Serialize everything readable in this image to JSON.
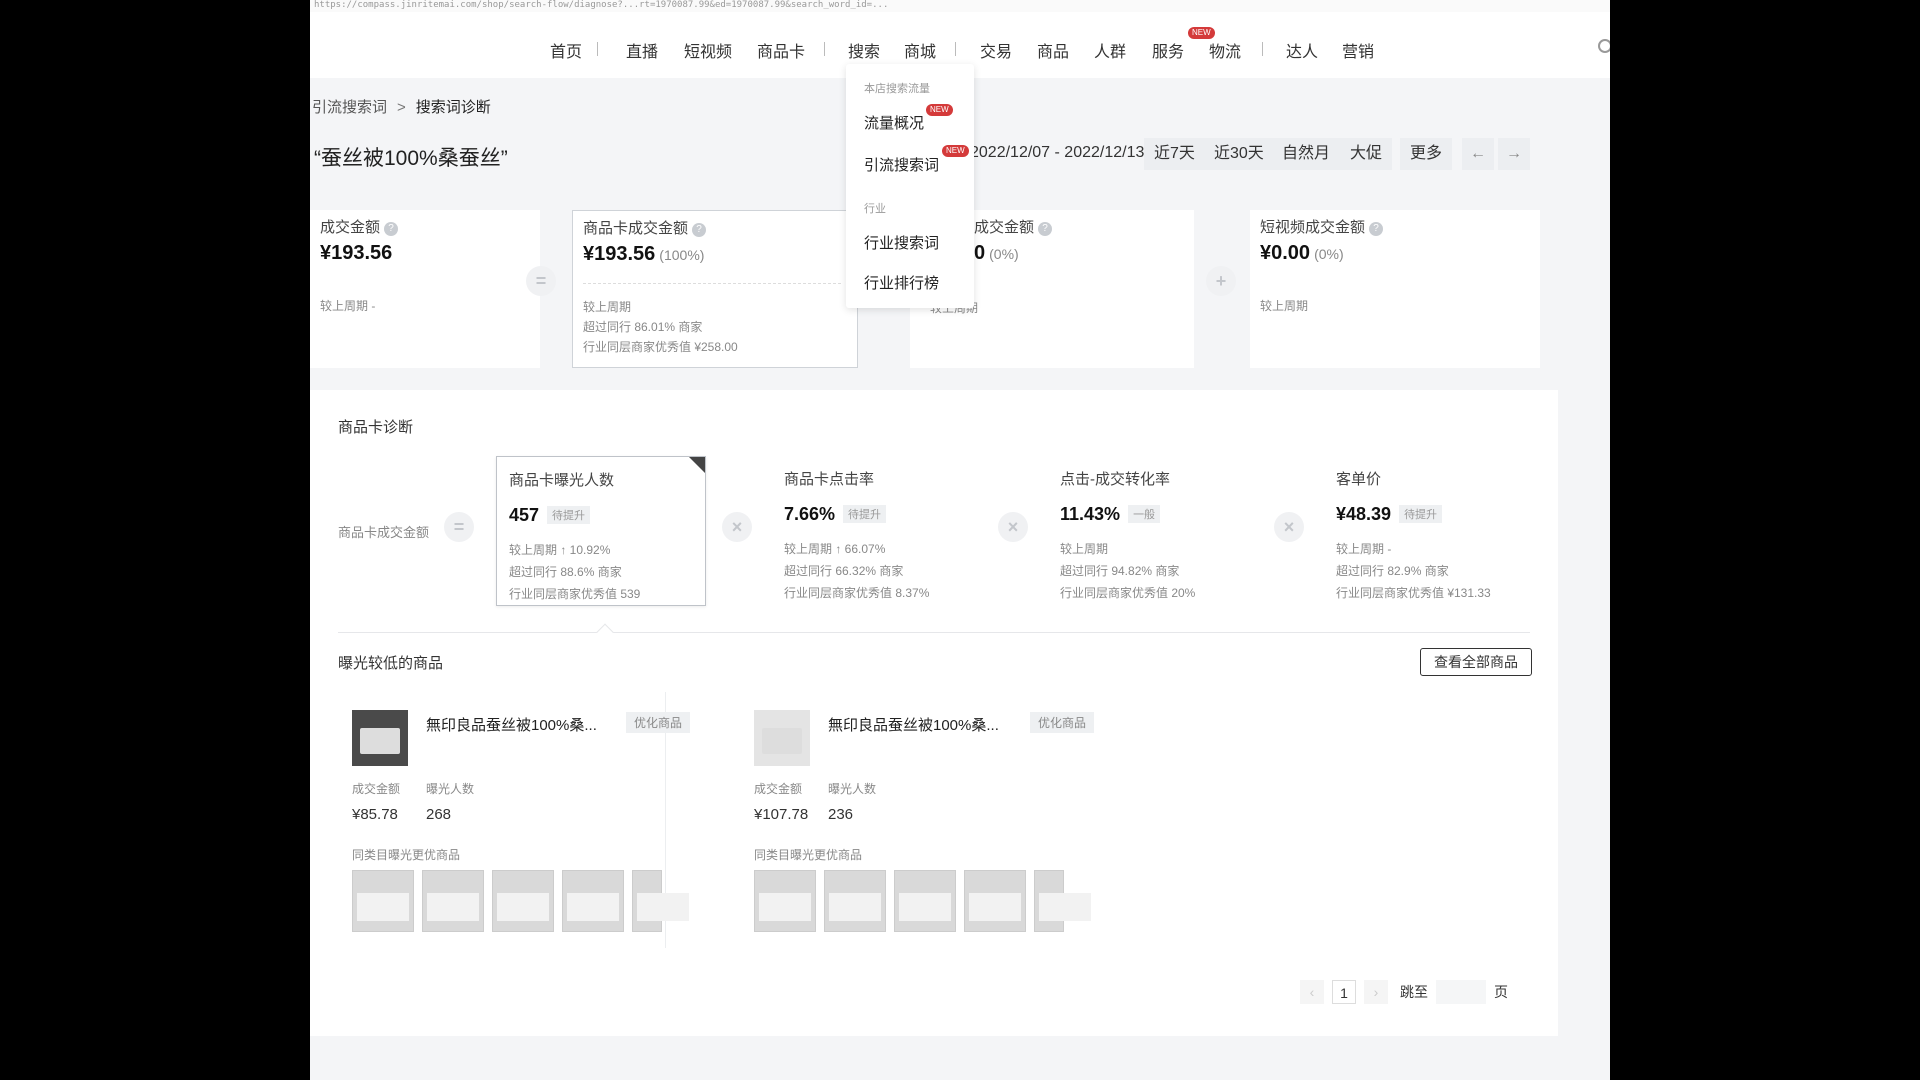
{
  "url": "https://compass.jinritemai.com/shop/search-flow/diagnose?...rt=1970087.99&ed=1970087.99&search_word_id=...",
  "topnav": {
    "items": [
      "首页",
      "直播",
      "短视频",
      "商品卡",
      "搜索",
      "商城",
      "交易",
      "商品",
      "人群",
      "服务",
      "物流",
      "达人",
      "营销"
    ],
    "new_badge": "NEW"
  },
  "breadcrumb": {
    "parent": "引流搜索词",
    "current": "搜索词诊断"
  },
  "keyword": "“蚕丝被100%桑蚕丝”",
  "date_range": "2022/12/07 - 2022/12/13",
  "range_tabs": [
    "近7天",
    "近30天",
    "自然月",
    "大促",
    "更多"
  ],
  "dropdown": {
    "group1": "本店搜索流量",
    "item1": "流量概况",
    "item2": "引流搜索词",
    "group2": "行业",
    "item3": "行业搜索词",
    "item4": "行业排行榜",
    "new_badge": "NEW"
  },
  "metrics": [
    {
      "label": "成交金额",
      "value": "¥193.56",
      "pct": "",
      "sub": [
        "较上周期 -"
      ]
    },
    {
      "label": "商品卡成交金额",
      "value": "¥193.56",
      "pct": "(100%)",
      "sub": [
        "较上周期",
        "超过同行 86.01% 商家",
        "行业同层商家优秀值 ¥258.00"
      ]
    },
    {
      "label": "成交金额",
      "value": "0",
      "pct": "(0%)",
      "sub": [
        "较上周期"
      ]
    },
    {
      "label": "短视频成交金额",
      "value": "¥0.00",
      "pct": "(0%)",
      "sub": [
        "较上周期"
      ]
    }
  ],
  "diagnose": {
    "title": "商品卡诊断",
    "left_label": "商品卡成交金额",
    "cards": [
      {
        "label": "商品卡曝光人数",
        "value": "457",
        "tag": "待提升",
        "sub": [
          "较上周期 ↑ 10.92%",
          "超过同行 88.6% 商家",
          "行业同层商家优秀值 539"
        ]
      },
      {
        "label": "商品卡点击率",
        "value": "7.66%",
        "tag": "待提升",
        "sub": [
          "较上周期 ↑ 66.07%",
          "超过同行 66.32% 商家",
          "行业同层商家优秀值 8.37%"
        ]
      },
      {
        "label": "点击-成交转化率",
        "value": "11.43%",
        "tag": "一般",
        "sub": [
          "较上周期",
          "超过同行 94.82% 商家",
          "行业同层商家优秀值 20%"
        ]
      },
      {
        "label": "客单价",
        "value": "¥48.39",
        "tag": "待提升",
        "sub": [
          "较上周期 -",
          "超过同行 82.9% 商家",
          "行业同层商家优秀值 ¥131.33"
        ]
      }
    ]
  },
  "low_exposure": {
    "title": "曝光较低的商品",
    "view_all": "查看全部商品",
    "products": [
      {
        "name": "無印良品蚕丝被100%桑...",
        "tag": "优化商品",
        "k1": "成交金额",
        "k2": "曝光人数",
        "v1": "¥85.78",
        "v2": "268",
        "sim_label": "同类目曝光更优商品"
      },
      {
        "name": "無印良品蚕丝被100%桑...",
        "tag": "优化商品",
        "k1": "成交金额",
        "k2": "曝光人数",
        "v1": "¥107.78",
        "v2": "236",
        "sim_label": "同类目曝光更优商品"
      }
    ]
  },
  "pager": {
    "current": "1",
    "jump": "跳至",
    "page": "页"
  }
}
